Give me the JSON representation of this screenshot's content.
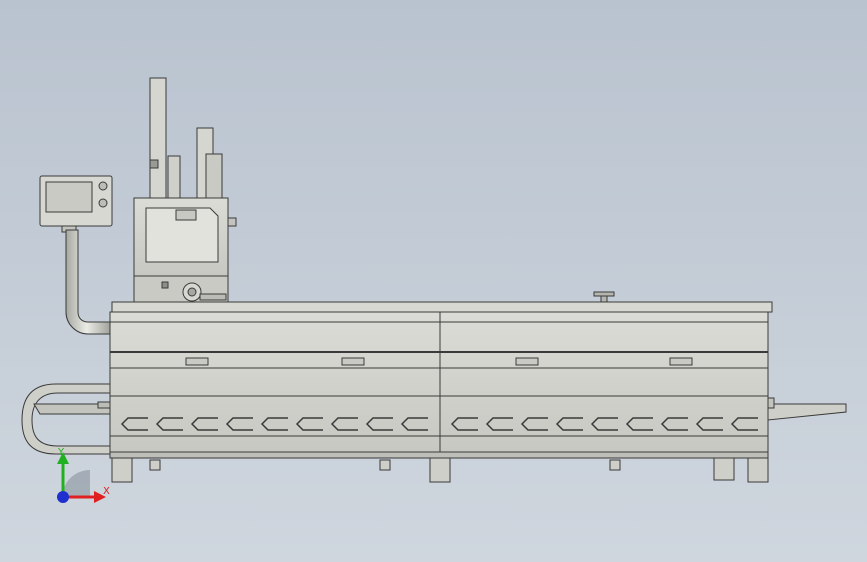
{
  "view": {
    "background_top": "#b9c3cf",
    "background_bottom": "#cfd6de",
    "body_color": "#d2d2cc",
    "edge_color": "#3a3a3a"
  },
  "triad": {
    "x_label": "X",
    "y_label": "Y",
    "x_color": "#e02020",
    "y_color": "#20b020",
    "z_color": "#2030d0"
  }
}
